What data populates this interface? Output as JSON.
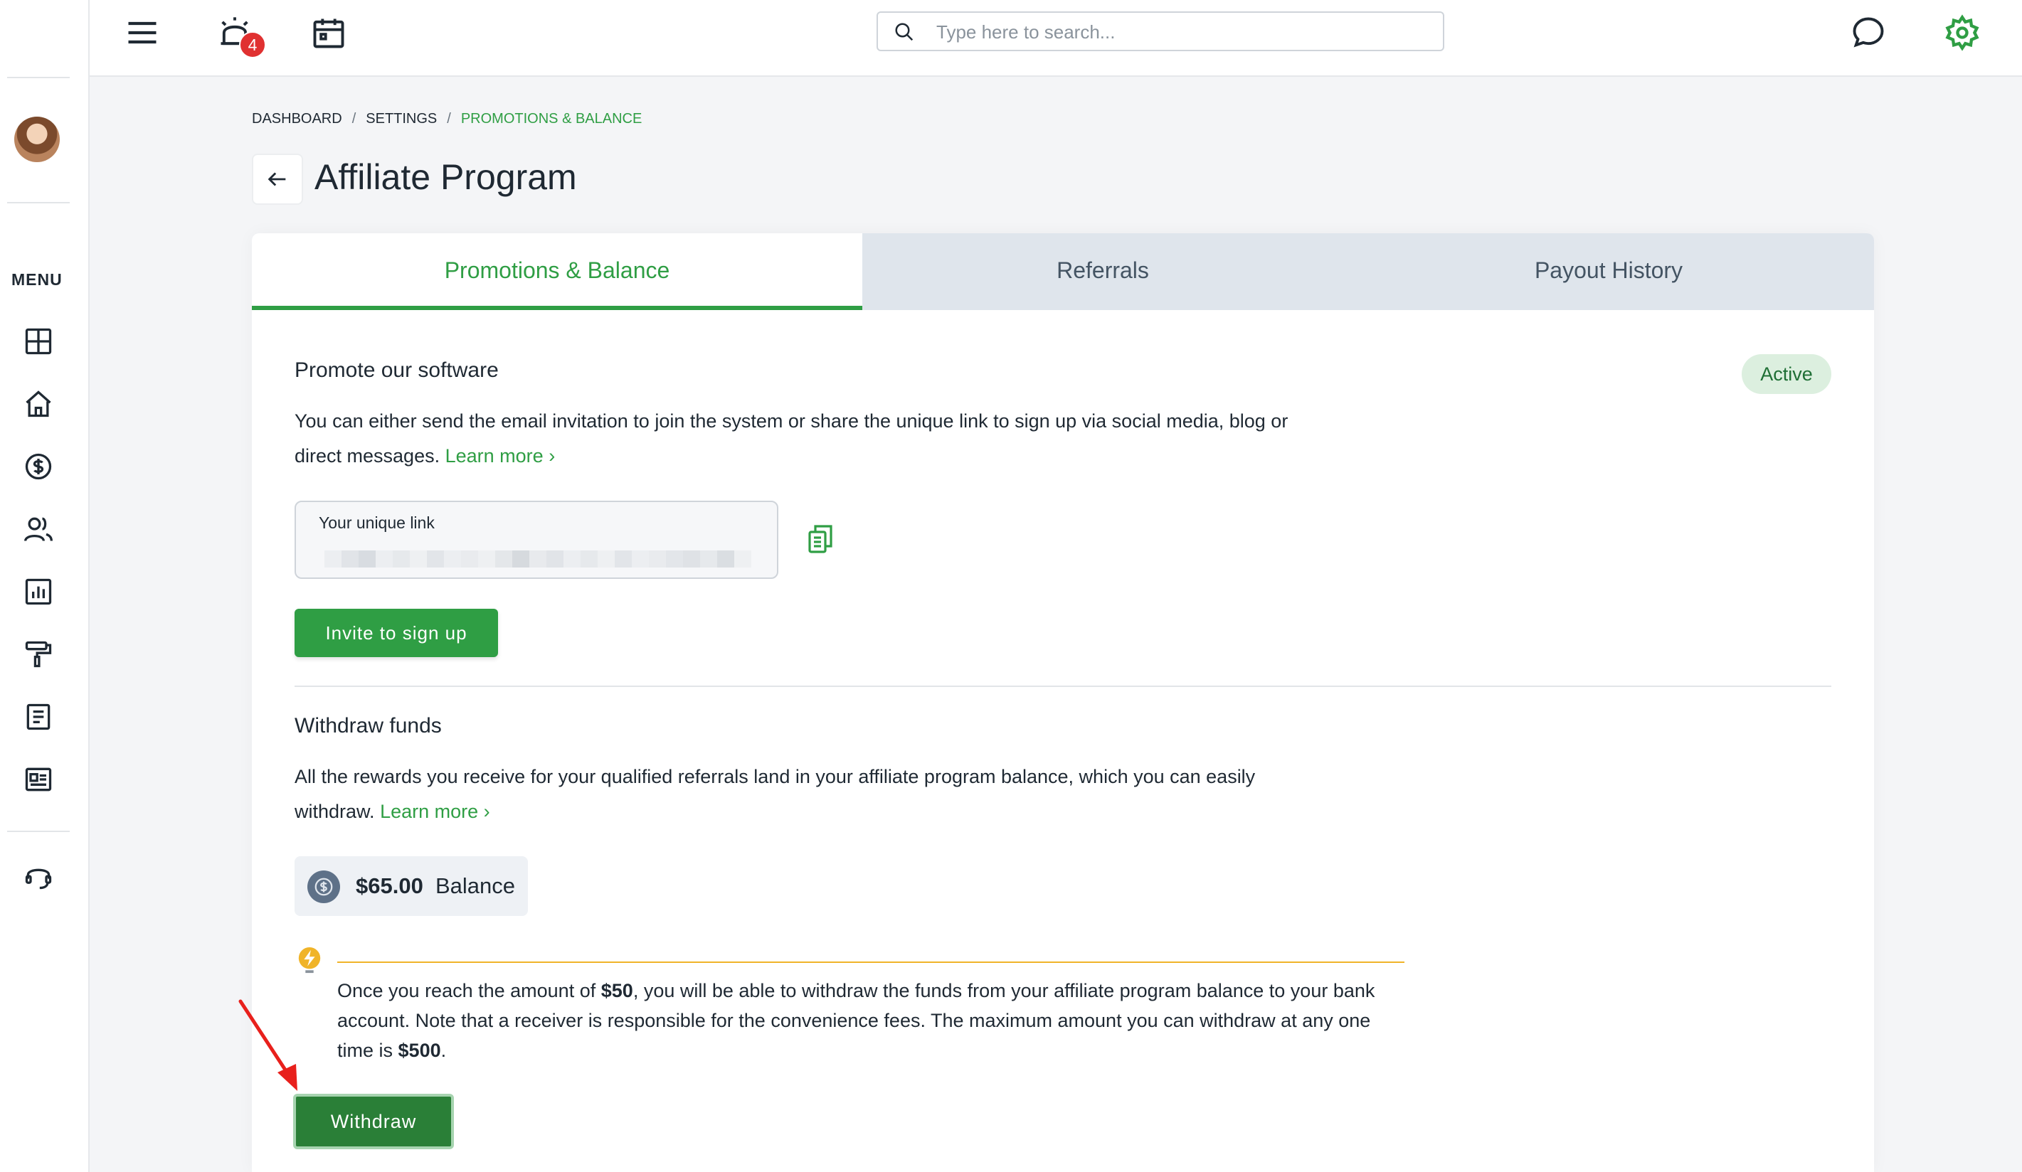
{
  "sidebar": {
    "menu_label": "MENU",
    "items": [
      {
        "icon": "dashboard-grid-icon"
      },
      {
        "icon": "home-icon"
      },
      {
        "icon": "dollar-icon"
      },
      {
        "icon": "users-icon"
      },
      {
        "icon": "reports-chart-icon"
      },
      {
        "icon": "paint-roller-icon"
      },
      {
        "icon": "document-icon"
      },
      {
        "icon": "newspaper-icon"
      },
      {
        "icon": "headset-icon"
      }
    ]
  },
  "topbar": {
    "notification_count": "4",
    "search_placeholder": "Type here to search..."
  },
  "breadcrumb": [
    "DASHBOARD",
    "SETTINGS",
    "PROMOTIONS & BALANCE"
  ],
  "page_title": "Affiliate Program",
  "tabs": [
    {
      "label": "Promotions & Balance",
      "active": true
    },
    {
      "label": "Referrals",
      "active": false
    },
    {
      "label": "Payout History",
      "active": false
    }
  ],
  "promote": {
    "title": "Promote our software",
    "status": "Active",
    "description_line1": "You can either send the email invitation to join the system or share the unique link to sign up via social media, blog or",
    "description_line2": "direct messages.",
    "learn_more": "Learn more",
    "link_label": "Your unique link",
    "invite_button": "Invite to sign up"
  },
  "withdraw": {
    "title": "Withdraw funds",
    "description_line1": "All the rewards you receive for your qualified referrals land in your affiliate program balance, which you can easily",
    "description_line2": "withdraw.",
    "learn_more": "Learn more",
    "balance_amount": "$65.00",
    "balance_label": "Balance",
    "note_part1": "Once you reach the amount of",
    "note_min": "$50",
    "note_part2": ", you will be able to withdraw the funds from your affiliate program balance to your bank account. Note that a receiver is responsible for the convenience fees. The maximum amount you can withdraw at any one time is",
    "note_max": "$500",
    "note_end": ".",
    "withdraw_button": "Withdraw"
  },
  "colors": {
    "accent_green": "#2f9e44",
    "dark_green": "#2a7f37",
    "tab_bar": "#dfe5ec",
    "note_line": "#f0b429",
    "badge_red": "#e03131",
    "annotation_arrow": "#e8201c"
  }
}
